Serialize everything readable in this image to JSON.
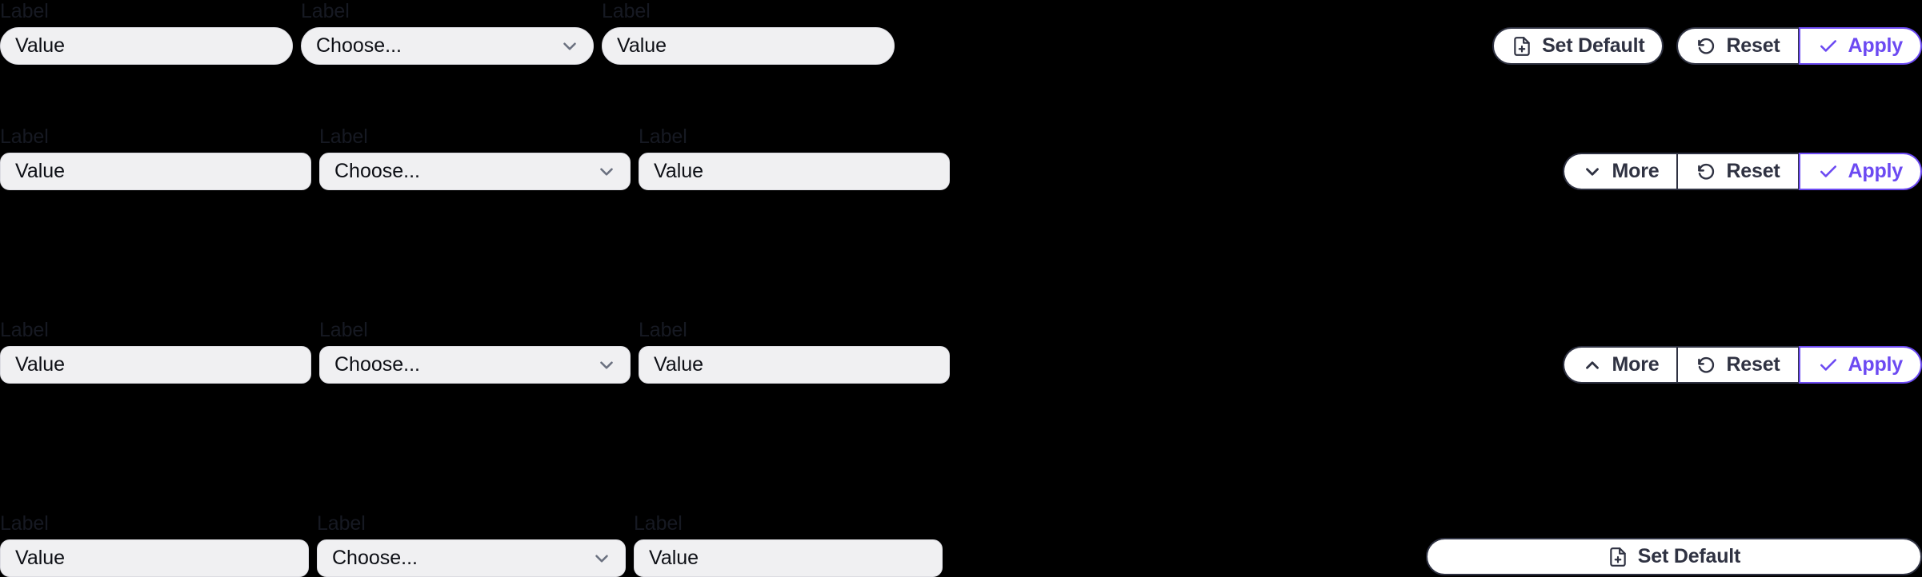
{
  "theme": {
    "background": "#000000",
    "field_bg": "#f0f0f2",
    "field_border": "#dcdce2",
    "label_color": "#161922",
    "button_bg": "#ffffff",
    "button_border": "#2f3242",
    "button_text": "#2f3242",
    "accent": "#6c4af2",
    "chevron_color": "#6b7180"
  },
  "common": {
    "label": "Label",
    "text_value": "Value",
    "select_value": "Choose...",
    "icons": {
      "chevron_down": "chevron-down-icon",
      "chevron_up": "chevron-up-icon",
      "file_plus": "file-plus-icon",
      "rotate_ccw": "rotate-counter-clockwise-icon",
      "check": "check-icon"
    }
  },
  "rows": [
    {
      "id": "row-1",
      "fields": [
        {
          "name": "text-field-1",
          "label": "Label",
          "value": "Value",
          "kind": "text"
        },
        {
          "name": "select-field-1",
          "label": "Label",
          "value": "Choose...",
          "kind": "select"
        },
        {
          "name": "text-field-2",
          "label": "Label",
          "value": "Value",
          "kind": "text"
        }
      ],
      "actions": {
        "set_default": {
          "label": "Set Default",
          "icon": "file-plus-icon"
        },
        "reset": {
          "label": "Reset",
          "icon": "rotate-counter-clockwise-icon"
        },
        "apply": {
          "label": "Apply",
          "icon": "check-icon"
        }
      }
    },
    {
      "id": "row-2",
      "fields": [
        {
          "name": "text-field-3",
          "label": "Label",
          "value": "Value",
          "kind": "text"
        },
        {
          "name": "select-field-2",
          "label": "Label",
          "value": "Choose...",
          "kind": "select"
        },
        {
          "name": "text-field-4",
          "label": "Label",
          "value": "Value",
          "kind": "text"
        }
      ],
      "actions": {
        "more": {
          "label": "More",
          "icon": "chevron-down-icon",
          "expanded": false
        },
        "reset": {
          "label": "Reset",
          "icon": "rotate-counter-clockwise-icon"
        },
        "apply": {
          "label": "Apply",
          "icon": "check-icon"
        }
      }
    },
    {
      "id": "row-3",
      "fields": [
        {
          "name": "text-field-5",
          "label": "Label",
          "value": "Value",
          "kind": "text"
        },
        {
          "name": "select-field-3",
          "label": "Label",
          "value": "Choose...",
          "kind": "select"
        },
        {
          "name": "text-field-6",
          "label": "Label",
          "value": "Value",
          "kind": "text"
        }
      ],
      "actions": {
        "more": {
          "label": "More",
          "icon": "chevron-up-icon",
          "expanded": true
        },
        "reset": {
          "label": "Reset",
          "icon": "rotate-counter-clockwise-icon"
        },
        "apply": {
          "label": "Apply",
          "icon": "check-icon"
        }
      }
    },
    {
      "id": "row-4",
      "fields": [
        {
          "name": "text-field-7",
          "label": "Label",
          "value": "Value",
          "kind": "text"
        },
        {
          "name": "select-field-4",
          "label": "Label",
          "value": "Choose...",
          "kind": "select"
        },
        {
          "name": "text-field-8",
          "label": "Label",
          "value": "Value",
          "kind": "text"
        }
      ],
      "actions": {
        "set_default": {
          "label": "Set Default",
          "icon": "file-plus-icon"
        }
      }
    }
  ]
}
